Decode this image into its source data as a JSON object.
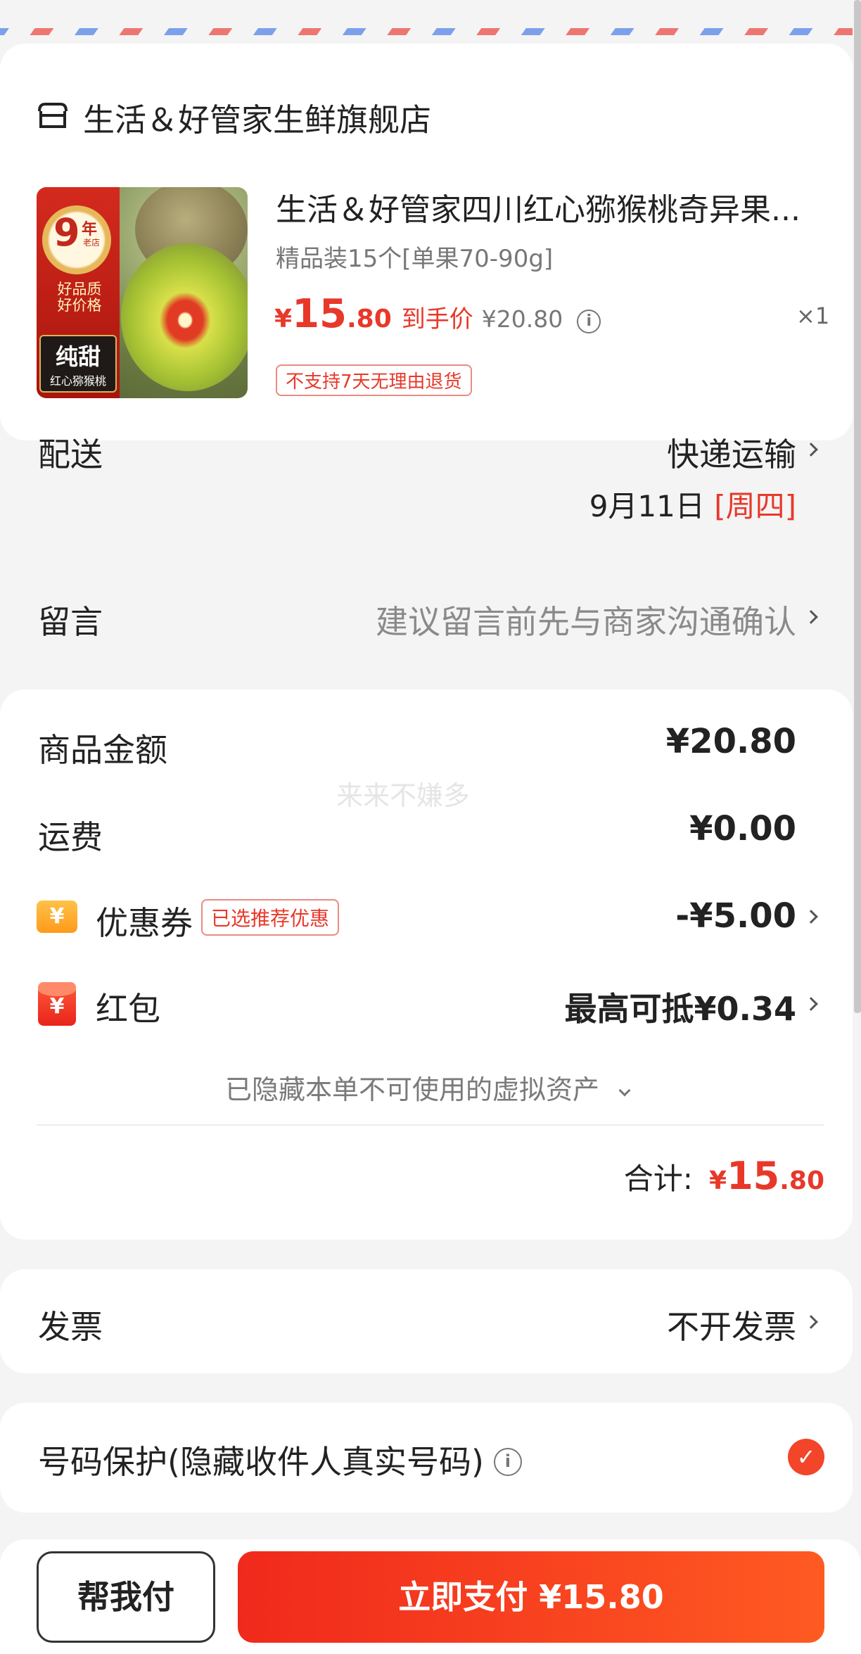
{
  "store": {
    "name": "生活＆好管家生鲜旗舰店"
  },
  "product": {
    "title": "生活＆好管家四川红心猕猴桃奇异果...",
    "spec": "精品装15个[单果70-90g]",
    "price_currency": "¥",
    "price_int": "15",
    "price_dec": ".80",
    "price_label": "到手价",
    "original_price": "¥20.80",
    "quantity": "×1",
    "return_policy": "不支持7天无理由退货",
    "image_badge": {
      "years": "9",
      "years_unit": "年",
      "store_age": "老店",
      "quality_line1": "好品质",
      "quality_line2": "好价格",
      "sweet": "纯甜",
      "kiwi_name": "红心猕猴桃"
    }
  },
  "delivery": {
    "label": "配送",
    "method": "快递运输",
    "date": "9月11日",
    "weekday": "[周四]"
  },
  "message": {
    "label": "留言",
    "placeholder": "建议留言前先与商家沟通确认"
  },
  "summary": {
    "goods_label": "商品金额",
    "goods_amount": "¥20.80",
    "shipping_label": "运费",
    "shipping_amount": "¥0.00",
    "coupon_label": "优惠券",
    "coupon_tag": "已选推荐优惠",
    "coupon_amount": "-¥5.00",
    "hongbao_label": "红包",
    "hongbao_amount": "最高可抵¥0.34",
    "hidden_assets": "已隐藏本单不可使用的虚拟资产",
    "total_label": "合计:",
    "total_currency": "¥",
    "total_int": "15",
    "total_dec": ".80",
    "watermark": "来来不嫌多"
  },
  "invoice": {
    "label": "发票",
    "value": "不开发票"
  },
  "privacy": {
    "label": "号码保护(隐藏收件人真实号码)",
    "checked": true
  },
  "footer": {
    "help_pay": "帮我付",
    "pay_now": "立即支付 ¥15.80"
  },
  "icons": {
    "store": "store-icon",
    "info": "info-icon",
    "coupon": "coupon-yen-icon",
    "hongbao": "red-packet-icon",
    "check": "check-circle-icon",
    "chevron": "chevron-right-icon"
  },
  "colors": {
    "accent": "#e8382a",
    "pay_button": "#f0291c",
    "text": "#222222",
    "muted": "#7a7a7a"
  }
}
